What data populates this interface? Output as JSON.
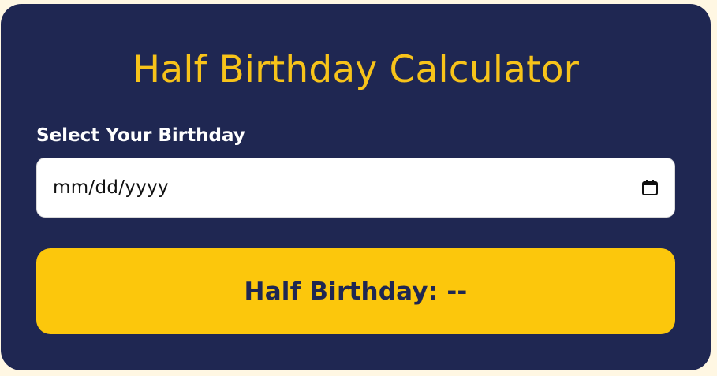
{
  "page": {
    "title": "Half Birthday Calculator"
  },
  "form": {
    "label": "Select Your Birthday",
    "date_placeholder": "mm/dd/yyyy",
    "calendar_icon": "calendar-icon"
  },
  "result": {
    "prefix": "Half Birthday:",
    "value": "--"
  },
  "colors": {
    "card_bg": "#1f2752",
    "accent": "#fcc70c",
    "title": "#f7c31a",
    "page_bg": "#fff7e3"
  }
}
